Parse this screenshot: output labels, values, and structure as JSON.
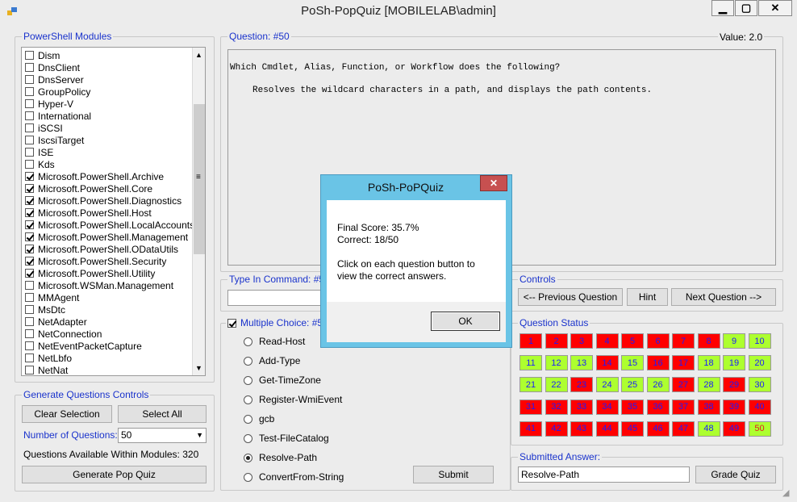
{
  "window": {
    "title": "PoSh-PopQuiz   [MOBILELAB\\admin]",
    "min": "▁",
    "max": "▢",
    "close": "✕"
  },
  "modules": {
    "label": "PowerShell Modules",
    "items": [
      {
        "label": "Dism",
        "checked": false
      },
      {
        "label": "DnsClient",
        "checked": false
      },
      {
        "label": "DnsServer",
        "checked": false
      },
      {
        "label": "GroupPolicy",
        "checked": false
      },
      {
        "label": "Hyper-V",
        "checked": false
      },
      {
        "label": "International",
        "checked": false
      },
      {
        "label": "iSCSI",
        "checked": false
      },
      {
        "label": "IscsiTarget",
        "checked": false
      },
      {
        "label": "ISE",
        "checked": false
      },
      {
        "label": "Kds",
        "checked": false
      },
      {
        "label": "Microsoft.PowerShell.Archive",
        "checked": true
      },
      {
        "label": "Microsoft.PowerShell.Core",
        "checked": true
      },
      {
        "label": "Microsoft.PowerShell.Diagnostics",
        "checked": true
      },
      {
        "label": "Microsoft.PowerShell.Host",
        "checked": true
      },
      {
        "label": "Microsoft.PowerShell.LocalAccounts",
        "checked": true
      },
      {
        "label": "Microsoft.PowerShell.Management",
        "checked": true
      },
      {
        "label": "Microsoft.PowerShell.ODataUtils",
        "checked": true
      },
      {
        "label": "Microsoft.PowerShell.Security",
        "checked": true
      },
      {
        "label": "Microsoft.PowerShell.Utility",
        "checked": true
      },
      {
        "label": "Microsoft.WSMan.Management",
        "checked": false
      },
      {
        "label": "MMAgent",
        "checked": false
      },
      {
        "label": "MsDtc",
        "checked": false
      },
      {
        "label": "NetAdapter",
        "checked": false
      },
      {
        "label": "NetConnection",
        "checked": false
      },
      {
        "label": "NetEventPacketCapture",
        "checked": false
      },
      {
        "label": "NetLbfo",
        "checked": false
      },
      {
        "label": "NetNat",
        "checked": false
      }
    ]
  },
  "generate": {
    "label": "Generate Questions Controls",
    "clear": "Clear Selection",
    "select_all": "Select All",
    "num_label": "Number of Questions:",
    "num_value": "50",
    "available": "Questions Available Within Modules: 320",
    "generate_btn": "Generate Pop Quiz"
  },
  "question": {
    "label": "Question: #50",
    "value_label": "Value:  2.0",
    "line1": "Which Cmdlet, Alias, Function, or Workflow does the following?",
    "line2": "Resolves the wildcard characters in a path, and displays the path contents."
  },
  "type_in": {
    "label": "Type In Command: #50",
    "value": ""
  },
  "multiple": {
    "label": "Multiple Choice: #50",
    "checked": true,
    "options": [
      {
        "label": "Read-Host",
        "selected": false
      },
      {
        "label": "Add-Type",
        "selected": false
      },
      {
        "label": "Get-TimeZone",
        "selected": false
      },
      {
        "label": "Register-WmiEvent",
        "selected": false
      },
      {
        "label": "gcb",
        "selected": false
      },
      {
        "label": "Test-FileCatalog",
        "selected": false
      },
      {
        "label": "Resolve-Path",
        "selected": true
      },
      {
        "label": "ConvertFrom-String",
        "selected": false
      }
    ],
    "submit": "Submit"
  },
  "controls": {
    "label": "Controls",
    "prev": "<-- Previous Question",
    "hint": "Hint",
    "next": "Next Question -->"
  },
  "status": {
    "label": "Question Status",
    "buttons": [
      {
        "n": "1",
        "s": "w"
      },
      {
        "n": "2",
        "s": "w"
      },
      {
        "n": "3",
        "s": "w"
      },
      {
        "n": "4",
        "s": "w"
      },
      {
        "n": "5",
        "s": "w"
      },
      {
        "n": "6",
        "s": "w"
      },
      {
        "n": "7",
        "s": "w"
      },
      {
        "n": "8",
        "s": "w"
      },
      {
        "n": "9",
        "s": "c"
      },
      {
        "n": "10",
        "s": "c"
      },
      {
        "n": "11",
        "s": "c"
      },
      {
        "n": "12",
        "s": "c"
      },
      {
        "n": "13",
        "s": "c"
      },
      {
        "n": "14",
        "s": "w"
      },
      {
        "n": "15",
        "s": "c"
      },
      {
        "n": "16",
        "s": "w"
      },
      {
        "n": "17",
        "s": "w"
      },
      {
        "n": "18",
        "s": "c"
      },
      {
        "n": "19",
        "s": "c"
      },
      {
        "n": "20",
        "s": "c"
      },
      {
        "n": "21",
        "s": "c"
      },
      {
        "n": "22",
        "s": "c"
      },
      {
        "n": "23",
        "s": "w"
      },
      {
        "n": "24",
        "s": "c"
      },
      {
        "n": "25",
        "s": "c"
      },
      {
        "n": "26",
        "s": "c"
      },
      {
        "n": "27",
        "s": "w"
      },
      {
        "n": "28",
        "s": "c"
      },
      {
        "n": "29",
        "s": "w"
      },
      {
        "n": "30",
        "s": "c"
      },
      {
        "n": "31",
        "s": "w"
      },
      {
        "n": "32",
        "s": "w"
      },
      {
        "n": "33",
        "s": "w"
      },
      {
        "n": "34",
        "s": "w"
      },
      {
        "n": "35",
        "s": "w"
      },
      {
        "n": "36",
        "s": "w"
      },
      {
        "n": "37",
        "s": "w"
      },
      {
        "n": "38",
        "s": "w"
      },
      {
        "n": "39",
        "s": "w"
      },
      {
        "n": "40",
        "s": "w"
      },
      {
        "n": "41",
        "s": "w"
      },
      {
        "n": "42",
        "s": "w"
      },
      {
        "n": "43",
        "s": "w"
      },
      {
        "n": "44",
        "s": "w"
      },
      {
        "n": "45",
        "s": "w"
      },
      {
        "n": "46",
        "s": "w"
      },
      {
        "n": "47",
        "s": "w"
      },
      {
        "n": "48",
        "s": "c"
      },
      {
        "n": "49",
        "s": "w"
      },
      {
        "n": "50",
        "s": "s"
      }
    ]
  },
  "submitted": {
    "label": "Submitted Answer:",
    "value": "Resolve-Path",
    "grade": "Grade Quiz"
  },
  "dialog": {
    "title": "PoSh-PoPQuiz",
    "close": "✕",
    "score": "Final Score:  35.7%",
    "correct": "Correct:  18/50",
    "msg1": "Click on each question button to",
    "msg2": "view the correct answers.",
    "ok": "OK"
  }
}
